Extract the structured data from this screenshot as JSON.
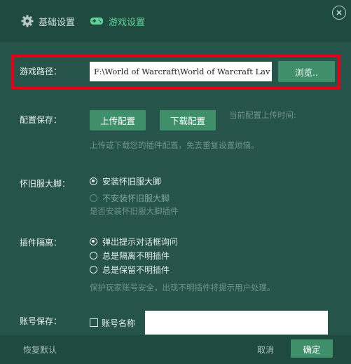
{
  "tabs": {
    "basic_label": "基础设置",
    "game_label": "游戏设置"
  },
  "game_path": {
    "label": "游戏路径：",
    "value": "F:\\World of Warcraft\\World of Warcraft Lav",
    "browse_label": "浏览.."
  },
  "config_save": {
    "label": "配置保存：",
    "upload_label": "上传配置",
    "download_label": "下载配置",
    "last_upload_hint": "当前配置上传时间:",
    "description": "上传或下载您的插件配置，免去重复设置烦恼。"
  },
  "classic_script": {
    "label": "怀旧服大脚：",
    "options": [
      "安装怀旧服大脚",
      "不安装怀旧服大脚"
    ],
    "selected": 0,
    "description": "是否安装怀旧服大脚插件"
  },
  "addon_isolation": {
    "label": "插件隔离：",
    "options": [
      "弹出提示对话框询问",
      "总是隔离不明插件",
      "总是保留不明插件"
    ],
    "selected": 0,
    "description": "保护玩家账号安全，出现不明插件将提示用户处理。"
  },
  "account_save": {
    "label": "账号保存：",
    "checkbox_label": "账号名称",
    "value": ""
  },
  "footer": {
    "restore_label": "恢复默认",
    "cancel_label": "取消",
    "ok_label": "确定"
  },
  "colors": {
    "background": "#26544a",
    "header": "#1f4a40",
    "accent": "#3f8f6a",
    "active_tab": "#5fd39a",
    "highlight": "#e50018"
  },
  "icons": {
    "basic_tab": "gear-icon",
    "game_tab": "gamepad-icon",
    "close": "close-icon"
  }
}
